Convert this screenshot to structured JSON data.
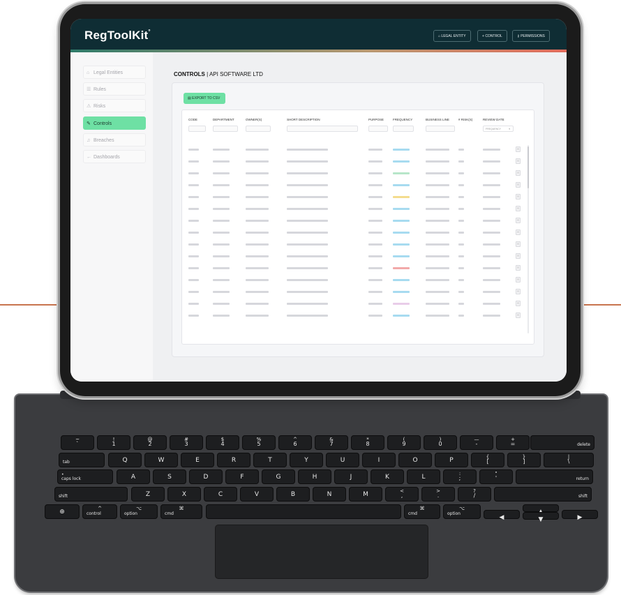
{
  "app": {
    "brand": "RegToolKit",
    "brand_mark": "°",
    "top_buttons": [
      {
        "icon": "home-icon",
        "glyph": "⌂",
        "label": "LEGAL ENTITY"
      },
      {
        "icon": "plus-icon",
        "glyph": "+",
        "label": "CONTROL"
      },
      {
        "icon": "key-icon",
        "glyph": "⚷",
        "label": "PERMISSIONS"
      }
    ],
    "accent_color": "#6ee0a4",
    "topbar_color": "#0f2d34"
  },
  "sidebar": {
    "items": [
      {
        "icon": "home-icon",
        "glyph": "⌂",
        "label": "Legal Entities",
        "active": false
      },
      {
        "icon": "list-icon",
        "glyph": "☰",
        "label": "Rules",
        "active": false
      },
      {
        "icon": "warning-icon",
        "glyph": "⚠",
        "label": "Risks",
        "active": false
      },
      {
        "icon": "edit-icon",
        "glyph": "✎",
        "label": "Controls",
        "active": true
      },
      {
        "icon": "bell-icon",
        "glyph": "♫",
        "label": "Breaches",
        "active": false
      },
      {
        "icon": "arrow-left-icon",
        "glyph": "←",
        "label": "Dashboards",
        "active": false
      }
    ]
  },
  "page": {
    "title_bold": "CONTROLS",
    "title_rest": " | API SOFTWARE LTD",
    "export_label": "EXPORT TO CSV",
    "export_glyph": "▤"
  },
  "table": {
    "columns": [
      "CODE",
      "DEPARTMENT",
      "OWNER(S)",
      "SHORT DESCRIPTION",
      "PURPOSE",
      "FREQUENCY",
      "BUSINESS LINE",
      "# RISK(S)",
      "REVIEW DATE"
    ],
    "review_filter_placeholder": "FREQUENCY",
    "review_filter_glyph": "▾",
    "row_action_glyph": "≡",
    "frequency_colors": [
      "#a7dbf0",
      "#a7dbf0",
      "#b7e6c9",
      "#a7dbf0",
      "#f4dc8e",
      "#a7dbf0",
      "#a7dbf0",
      "#a7dbf0",
      "#a7dbf0",
      "#a7dbf0",
      "#f2a9a9",
      "#a7dbf0",
      "#a7dbf0",
      "#e9cde9",
      "#a7dbf0"
    ],
    "row_count": 15
  },
  "keyboard": {
    "row1": [
      {
        "top": "~",
        "bottom": "`"
      },
      {
        "top": "!",
        "bottom": "1"
      },
      {
        "top": "@",
        "bottom": "2"
      },
      {
        "top": "#",
        "bottom": "3"
      },
      {
        "top": "$",
        "bottom": "4"
      },
      {
        "top": "%",
        "bottom": "5"
      },
      {
        "top": "^",
        "bottom": "6"
      },
      {
        "top": "&",
        "bottom": "7"
      },
      {
        "top": "*",
        "bottom": "8"
      },
      {
        "top": "(",
        "bottom": "9"
      },
      {
        "top": ")",
        "bottom": "0"
      },
      {
        "top": "—",
        "bottom": "-"
      },
      {
        "top": "+",
        "bottom": "="
      }
    ],
    "delete": "delete",
    "tab": "tab",
    "row2": [
      "Q",
      "W",
      "E",
      "R",
      "T",
      "Y",
      "U",
      "I",
      "O",
      "P"
    ],
    "row2_sym": [
      {
        "top": "{",
        "bottom": "["
      },
      {
        "top": "}",
        "bottom": "]"
      },
      {
        "top": "|",
        "bottom": "\\"
      }
    ],
    "caps": "caps lock",
    "caps_dot": "•",
    "row3": [
      "A",
      "S",
      "D",
      "F",
      "G",
      "H",
      "J",
      "K",
      "L"
    ],
    "row3_sym": [
      {
        "top": ":",
        "bottom": ";"
      },
      {
        "top": "\"",
        "bottom": "'"
      }
    ],
    "return": "return",
    "shift": "shift",
    "row4": [
      "Z",
      "X",
      "C",
      "V",
      "B",
      "N",
      "M"
    ],
    "row4_sym": [
      {
        "top": "<",
        "bottom": ","
      },
      {
        "top": ">",
        "bottom": "."
      },
      {
        "top": "?",
        "bottom": "/"
      }
    ],
    "globe": "⊕",
    "control": "control",
    "control_sym": "^",
    "option": "option",
    "option_sym": "⌥",
    "cmd": "cmd",
    "cmd_sym": "⌘",
    "arrows": {
      "left": "◀",
      "up": "▲",
      "down": "▼",
      "right": "▶"
    }
  }
}
